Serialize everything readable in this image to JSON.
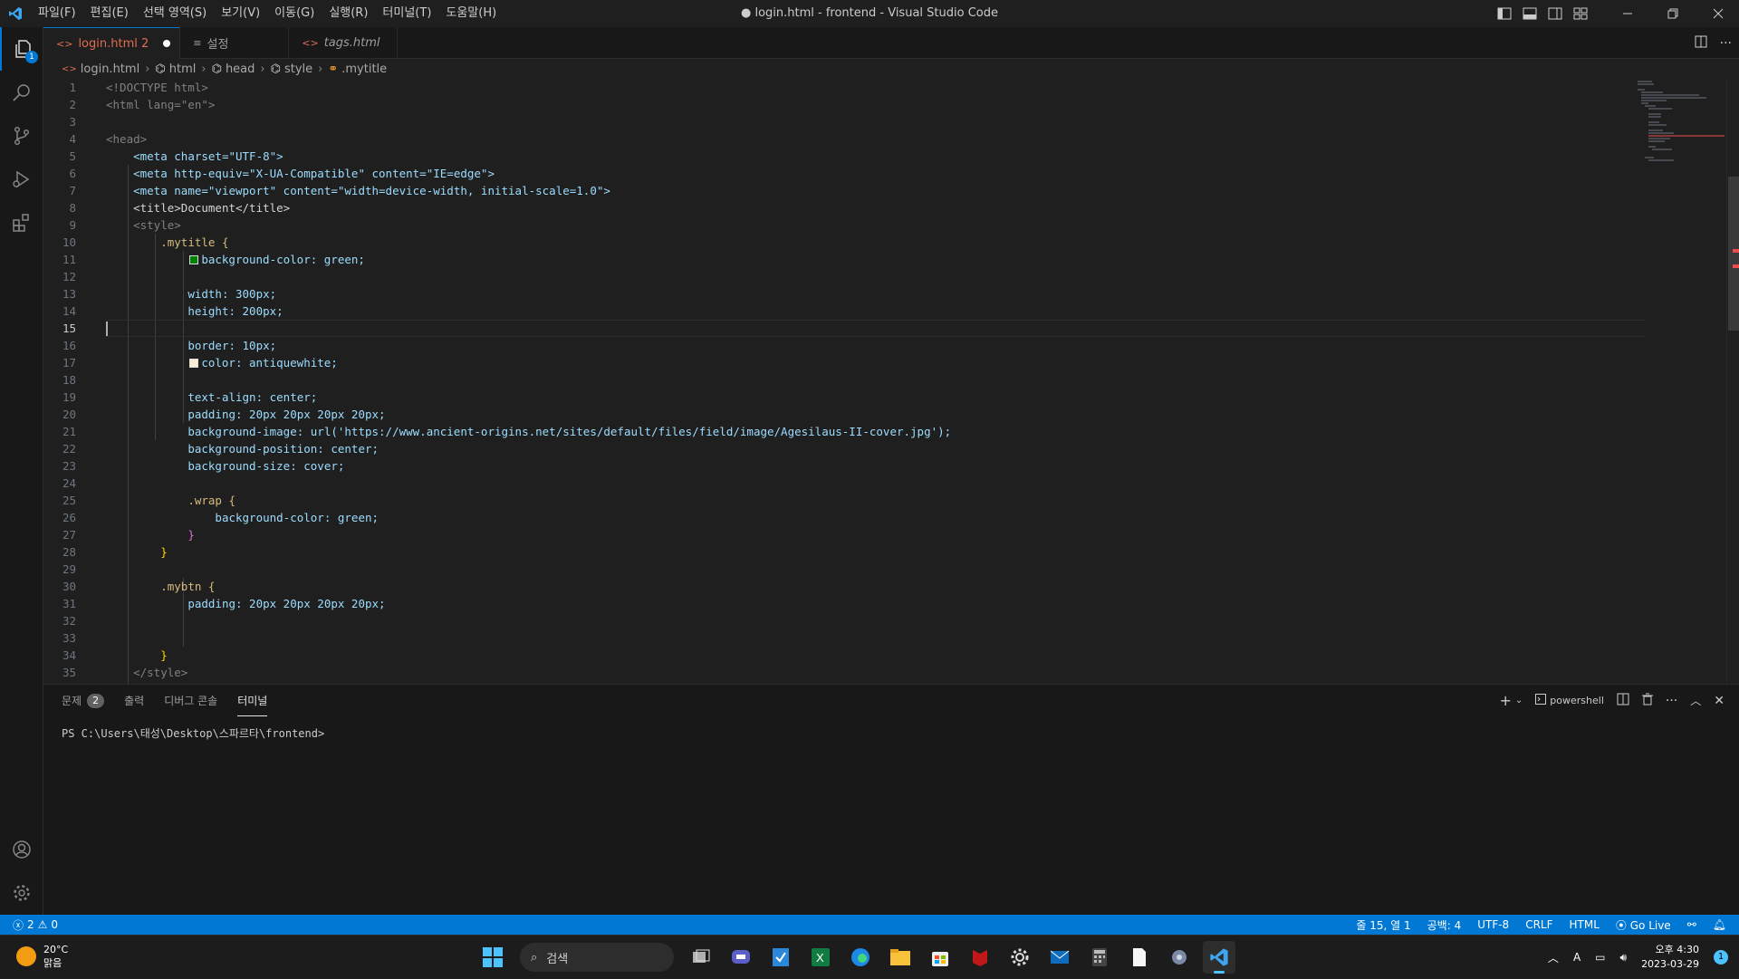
{
  "titlebar": {
    "menu": [
      "파일(F)",
      "편집(E)",
      "선택 영역(S)",
      "보기(V)",
      "이동(G)",
      "실행(R)",
      "터미널(T)",
      "도움말(H)"
    ],
    "title": "● login.html - frontend - Visual Studio Code"
  },
  "activity": {
    "explorer_badge": "1"
  },
  "tabs": [
    {
      "label": "login.html 2",
      "dirty": true,
      "active": true
    },
    {
      "label": "설정",
      "active": false
    },
    {
      "label": "tags.html",
      "active": false
    }
  ],
  "breadcrumb": [
    "login.html",
    "html",
    "head",
    "style",
    ".mytitle"
  ],
  "editor": {
    "line_numbers": [
      "1",
      "2",
      "3",
      "4",
      "5",
      "6",
      "7",
      "8",
      "9",
      "10",
      "11",
      "12",
      "13",
      "14",
      "15",
      "16",
      "17",
      "18",
      "19",
      "20",
      "21",
      "22",
      "23",
      "24",
      "25",
      "26",
      "27",
      "28",
      "29",
      "30",
      "31",
      "32",
      "33",
      "34",
      "35"
    ],
    "current_line": 15,
    "code_1": "<!DOCTYPE html>",
    "code_2": "<html lang=\"en\">",
    "code_4": "<head>",
    "code_5": "<meta charset=\"UTF-8\">",
    "code_6": "<meta http-equiv=\"X-UA-Compatible\" content=\"IE=edge\">",
    "code_7": "<meta name=\"viewport\" content=\"width=device-width, initial-scale=1.0\">",
    "code_8": "<title>Document</title>",
    "code_9": "<style>",
    "code_10": ".mytitle {",
    "code_11": "background-color: green;",
    "code_13": "width: 300px;",
    "code_14": "height: 200px;",
    "code_16": "border: 10px;",
    "code_17": "color: antiquewhite;",
    "code_19": "text-align: center;",
    "code_20": "padding: 20px 20px 20px 20px;",
    "code_21": "background-image: url('https://www.ancient-origins.net/sites/default/files/field/image/Agesilaus-II-cover.jpg');",
    "code_22": "background-position: center;",
    "code_23": "background-size: cover;",
    "code_25": ".wrap {",
    "code_26": "background-color: green;",
    "code_27": "}",
    "code_28": "}",
    "code_30": ".mybtn {",
    "code_31": "padding: 20px 20px 20px 20px;",
    "code_34": "}",
    "code_35": "</style>"
  },
  "colors": {
    "accent": "#0078d4",
    "swatch_green": "#008000",
    "swatch_antiquewhite": "#faebd7"
  },
  "panel": {
    "tabs": [
      {
        "label": "문제",
        "count": "2"
      },
      {
        "label": "출력"
      },
      {
        "label": "디버그 콘솔"
      },
      {
        "label": "터미널",
        "active": true
      }
    ],
    "shell_label": "powershell",
    "terminal_prompt": "PS C:\\Users\\태성\\Desktop\\스파르타\\frontend>"
  },
  "statusbar": {
    "errors": "2",
    "warnings": "0",
    "position": "줄 15, 열 1",
    "spaces": "공백: 4",
    "encoding": "UTF-8",
    "eol": "CRLF",
    "language": "HTML",
    "golive": "Go Live"
  },
  "taskbar": {
    "temperature": "20°C",
    "weather": "맑음",
    "search_placeholder": "검색",
    "time": "오후 4:30",
    "date": "2023-03-29",
    "notification_count": "1"
  }
}
